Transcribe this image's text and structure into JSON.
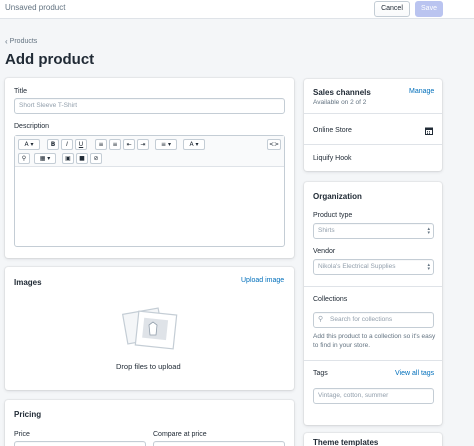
{
  "topbar": {
    "title": "Unsaved product",
    "cancel_label": "Cancel",
    "save_label": "Save"
  },
  "breadcrumb": {
    "label": "Products"
  },
  "page_title": "Add product",
  "main": {
    "title_label": "Title",
    "title_placeholder": "Short Sleeve T-Shirt",
    "description_label": "Description",
    "toolbar": {
      "font": "A",
      "bold": "B",
      "italic": "I",
      "underline": "U",
      "bullet_icon": "list-bullet-icon",
      "number_icon": "list-number-icon",
      "outdent_icon": "outdent-icon",
      "indent_icon": "indent-icon",
      "align_icon": "align-icon",
      "color": "A",
      "html": "<>",
      "link_icon": "link-icon",
      "table_icon": "table-icon",
      "image_icon": "image-icon",
      "video_icon": "video-icon",
      "clear_icon": "clear-format-icon"
    },
    "images_heading": "Images",
    "upload_link": "Upload image",
    "drop_text": "Drop files to upload",
    "pricing_heading": "Pricing",
    "price_label": "Price",
    "compare_label": "Compare at price"
  },
  "sidebar": {
    "sales_channels": {
      "heading": "Sales channels",
      "manage_link": "Manage",
      "availability": "Available on 2 of 2",
      "channels": [
        "Online Store",
        "Liquify Hook"
      ]
    },
    "organization": {
      "heading": "Organization",
      "product_type_label": "Product type",
      "product_type_value": "Shirts",
      "vendor_label": "Vendor",
      "vendor_value": "Nikola's Electrical Supplies",
      "collections_label": "Collections",
      "collections_placeholder": "Search for collections",
      "collections_help": "Add this product to a collection so it's easy to find in your store.",
      "tags_label": "Tags",
      "tags_link": "View all tags",
      "tags_placeholder": "Vintage, cotton, summer"
    },
    "theme_templates": {
      "heading": "Theme templates"
    }
  },
  "colors": {
    "accent": "#006fbb",
    "primary_disabled": "#bac4f0",
    "background": "#f4f6f8"
  }
}
